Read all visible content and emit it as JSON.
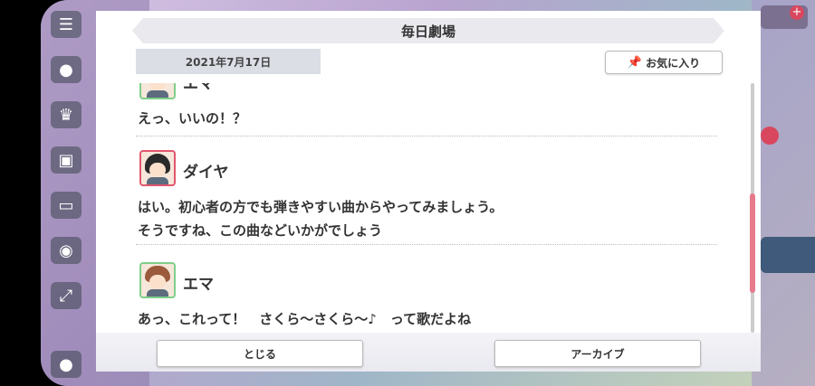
{
  "modal": {
    "title": "毎日劇場",
    "date": "2021年7月17日",
    "favorite_label": "お気に入り",
    "close_label": "とじる",
    "archive_label": "アーカイブ"
  },
  "messages": [
    {
      "speaker": "エマ",
      "lines": [
        "えっ、いいの！？"
      ]
    },
    {
      "speaker": "ダイヤ",
      "lines": [
        "はい。初心者の方でも弾きやすい曲からやってみましょう。",
        "そうですね、この曲などいかがでしょう"
      ]
    },
    {
      "speaker": "エマ",
      "lines": [
        "あっ、これって！　さくら〜さくら〜♪　って歌だよね"
      ]
    }
  ],
  "scroll": {
    "position_fraction": 0.48
  },
  "colors": {
    "accent_pink": "#e7798c",
    "avatar_green": "#7fcf8a",
    "avatar_red": "#e2566d"
  }
}
